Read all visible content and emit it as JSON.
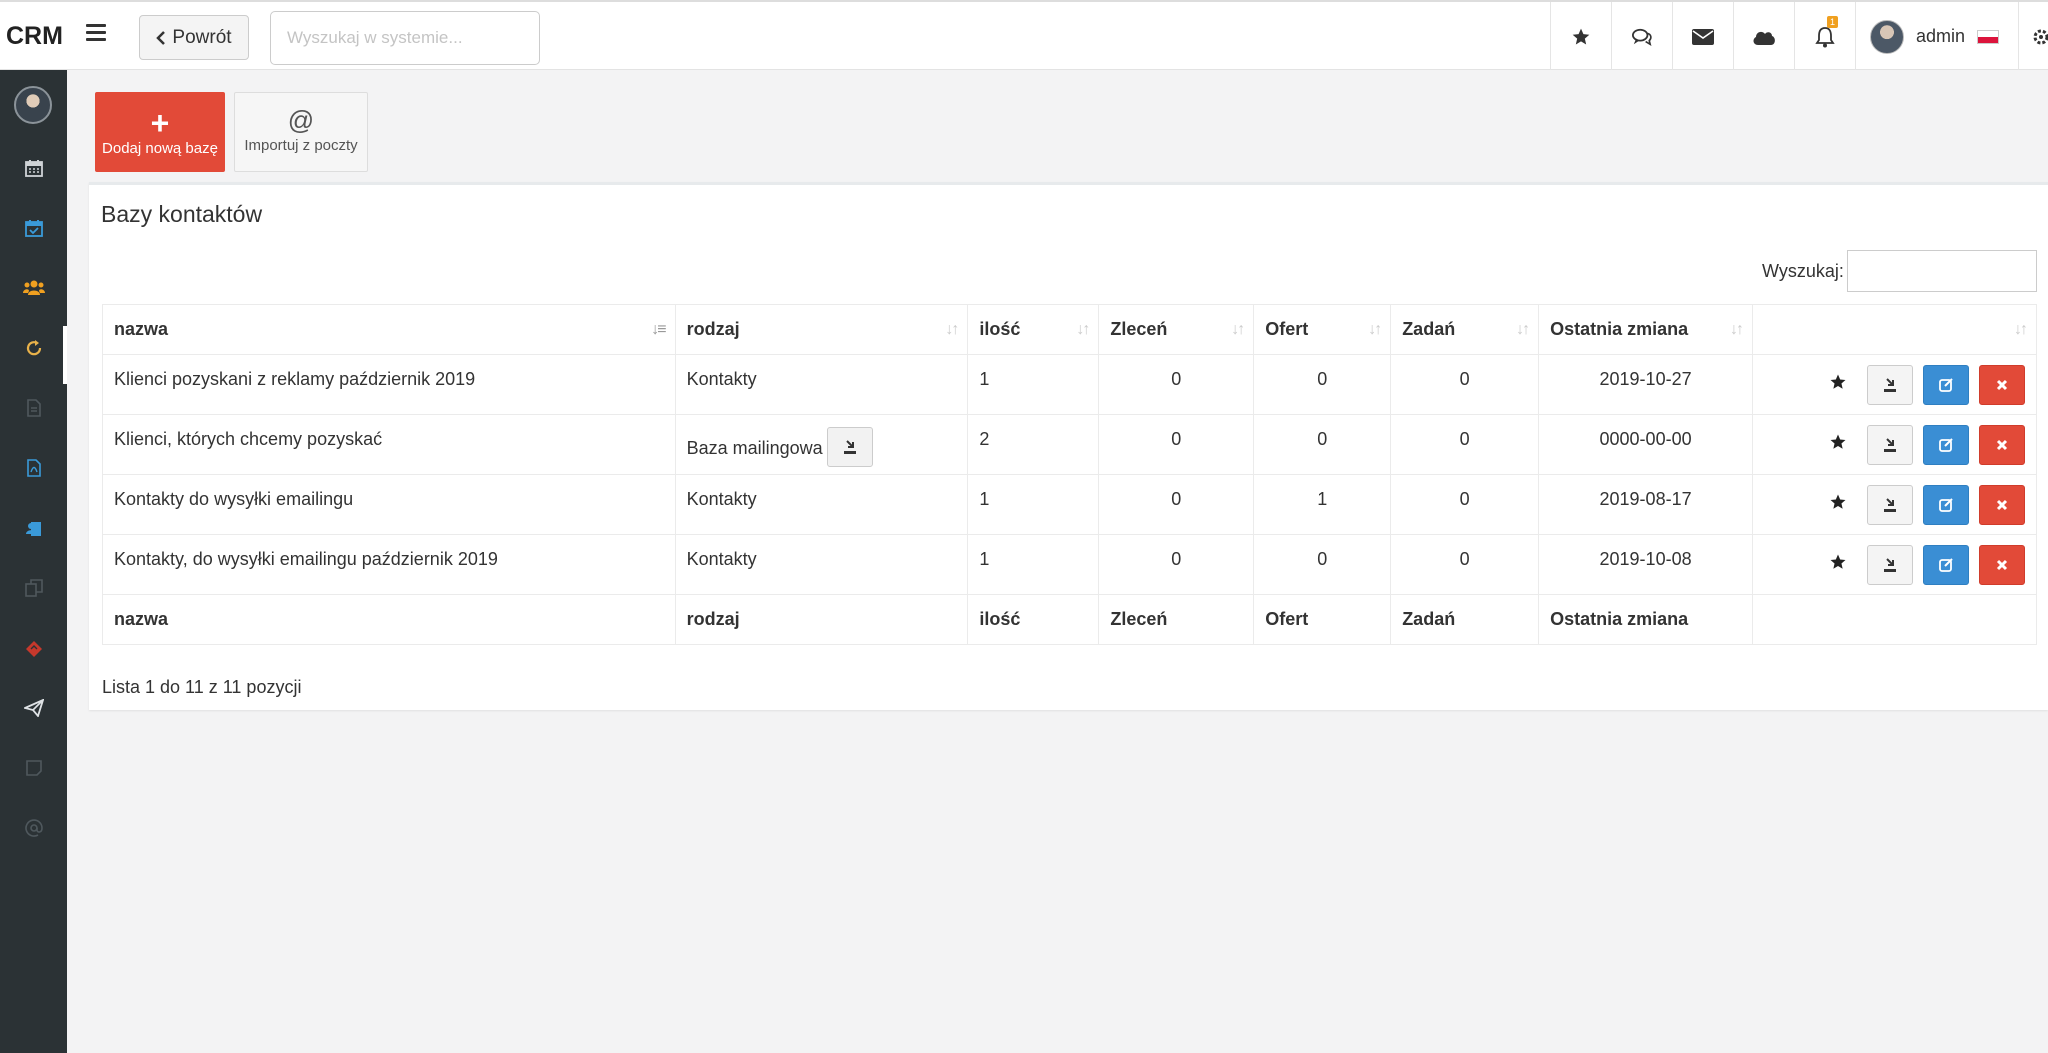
{
  "app": {
    "logo": "CRM"
  },
  "topbar": {
    "back_label": "Powrót",
    "search_placeholder": "Wyszukaj w systemie...",
    "notifications_count": "1",
    "user_name": "admin"
  },
  "sidebar": {
    "items": [
      {
        "icon": "calendar-icon"
      },
      {
        "icon": "calendar-check-icon"
      },
      {
        "icon": "users-icon",
        "active": true
      },
      {
        "icon": "refresh-icon"
      },
      {
        "icon": "file-icon"
      },
      {
        "icon": "pdf-file-icon"
      },
      {
        "icon": "clipboard-user-icon"
      },
      {
        "icon": "copy-icon"
      },
      {
        "icon": "ticket-icon"
      },
      {
        "icon": "paper-plane-icon"
      },
      {
        "icon": "note-icon"
      },
      {
        "icon": "at-icon"
      }
    ]
  },
  "toolbar": {
    "add_label": "Dodaj nową bazę",
    "import_label": "Importuj z poczty",
    "import_symbol": "@"
  },
  "panel": {
    "title": "Bazy kontaktów",
    "filter_label": "Wyszukaj:",
    "info": "Lista 1 do 11 z 11 pozycji"
  },
  "table": {
    "columns": [
      "nazwa",
      "rodzaj",
      "ilość",
      "Zleceń",
      "Ofert",
      "Zadań",
      "Ostatnia zmiana"
    ],
    "rows": [
      {
        "nazwa": "Klienci pozyskani z reklamy październik 2019",
        "rodzaj": "Kontakty",
        "ilosc": "1",
        "zlecen": "0",
        "ofert": "0",
        "zadan": "0",
        "zmiana": "2019-10-27"
      },
      {
        "nazwa": "Klienci, których chcemy pozyskać",
        "rodzaj": "Baza mailingowa",
        "ilosc": "2",
        "zlecen": "0",
        "ofert": "0",
        "zadan": "0",
        "zmiana": "0000-00-00"
      },
      {
        "nazwa": "Kontakty do wysyłki emailingu",
        "rodzaj": "Kontakty",
        "ilosc": "1",
        "zlecen": "0",
        "ofert": "1",
        "zadan": "0",
        "zmiana": "2019-08-17"
      },
      {
        "nazwa": "Kontakty, do wysyłki emailingu październik 2019",
        "rodzaj": "Kontakty",
        "ilosc": "1",
        "zlecen": "0",
        "ofert": "0",
        "zadan": "0",
        "zmiana": "2019-10-08"
      }
    ]
  },
  "colors": {
    "sidebar_bg": "#2b3235",
    "accent_red": "#e24a38",
    "accent_blue": "#3a8ed4",
    "users_icon": "#f0a020",
    "calendar_check_icon": "#3a9ad9"
  }
}
